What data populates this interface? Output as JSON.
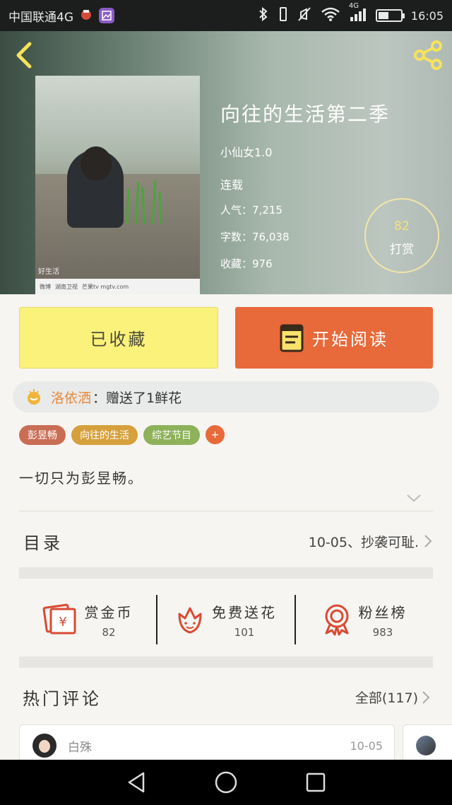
{
  "status_bar": {
    "carrier": "中国联通4G",
    "time": "16:05",
    "network": "4G",
    "battery_level": 0.45
  },
  "header": {
    "title": "向往的生活第二季",
    "author": "小仙女1.0",
    "status": "连载",
    "popularity_label": "人气：",
    "popularity_value": "7,215",
    "words_label": "字数：",
    "words_value": "76,038",
    "favorites_label": "收藏：",
    "favorites_value": "976",
    "reward_count": "82",
    "reward_label": "打赏",
    "cover_watermark": "好生活",
    "cover_logos": [
      "微博",
      "湖南卫视",
      "芒果tv mgtv.com"
    ]
  },
  "actions": {
    "collected_label": "已收藏",
    "read_label": "开始阅读"
  },
  "gift_banner": {
    "user": "洛依洒",
    "text": "：赠送了1鲜花"
  },
  "tags": [
    {
      "label": "彭昱畅",
      "color": "#c96e55"
    },
    {
      "label": "向往的生活",
      "color": "#d6a03c"
    },
    {
      "label": "综艺节目",
      "color": "#8db25a"
    }
  ],
  "tag_add_label": "+",
  "summary": "一切只为彭昱畅。",
  "toc": {
    "title": "目录",
    "latest": "10-05、抄袭可耻."
  },
  "features": [
    {
      "label": "赏金币",
      "value": "82"
    },
    {
      "label": "免费送花",
      "value": "101"
    },
    {
      "label": "粉丝榜",
      "value": "983"
    }
  ],
  "comments": {
    "title": "热门评论",
    "all_label": "全部(117)",
    "items": [
      {
        "name": "白殊",
        "date": "10-05"
      }
    ]
  },
  "colors": {
    "accent": "#e8693a",
    "collected_bg": "#fbf27c",
    "gold": "#f7e07c"
  }
}
